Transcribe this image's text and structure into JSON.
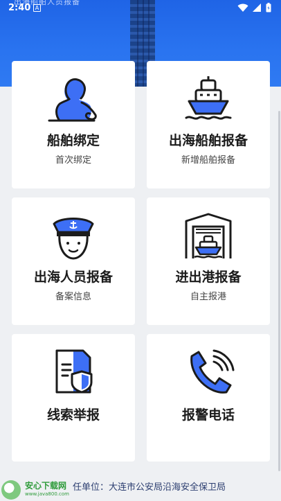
{
  "header": {
    "title": "出海船舶人员报备"
  },
  "status_bar": {
    "time": "2:40",
    "notice_icon": "A"
  },
  "cards": [
    {
      "title": "船舶绑定",
      "subtitle": "首次绑定",
      "icon": "person-icon"
    },
    {
      "title": "出海船舶报备",
      "subtitle": "新增船舶报备",
      "icon": "ship-icon"
    },
    {
      "title": "出海人员报备",
      "subtitle": "备案信息",
      "icon": "sailor-icon"
    },
    {
      "title": "进出港报备",
      "subtitle": "自主报港",
      "icon": "harbor-gate-icon"
    },
    {
      "title": "线索举报",
      "subtitle": "",
      "icon": "report-document-icon"
    },
    {
      "title": "报警电话",
      "subtitle": "",
      "icon": "phone-icon"
    }
  ],
  "footer": {
    "text": "任单位：大连市公安局沿海安全保卫局"
  },
  "watermark": {
    "name": "安心下载网",
    "url": "www.java800.com"
  },
  "colors": {
    "accent": "#3d6ff5",
    "header": "#2a74f0",
    "outline": "#1b1b1b"
  }
}
